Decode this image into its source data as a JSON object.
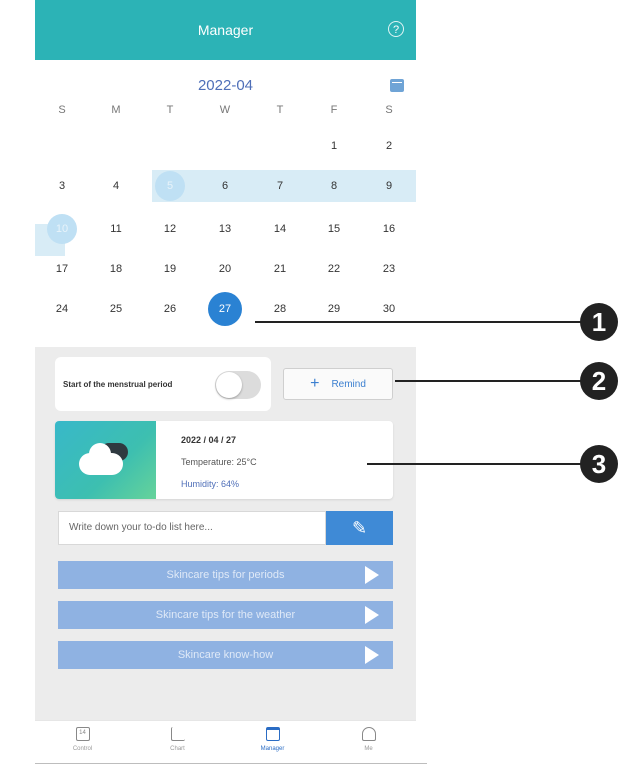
{
  "header": {
    "title": "Manager",
    "help_icon": "help-icon",
    "help_symbol": "?"
  },
  "calendar": {
    "month": "2022-04",
    "weekdays": [
      "S",
      "M",
      "T",
      "W",
      "T",
      "F",
      "S"
    ],
    "weeks": [
      [
        "",
        "",
        "",
        "",
        "",
        "1",
        "2"
      ],
      [
        "3",
        "4",
        "5",
        "6",
        "7",
        "8",
        "9"
      ],
      [
        "10",
        "11",
        "12",
        "13",
        "14",
        "15",
        "16"
      ],
      [
        "17",
        "18",
        "19",
        "20",
        "21",
        "22",
        "23"
      ],
      [
        "24",
        "25",
        "26",
        "27",
        "28",
        "29",
        "30"
      ]
    ],
    "selected_day": "27",
    "period_days": [
      "5",
      "6",
      "7",
      "8",
      "9",
      "10"
    ]
  },
  "period": {
    "label": "Start of the menstrual period",
    "toggle_on": false
  },
  "remind": {
    "label": "Remind",
    "icon": "plus-icon"
  },
  "weather": {
    "date": "2022 / 04 / 27",
    "temperature": "Temperature: 25°C",
    "humidity": "Humidity: 64%",
    "icon": "cloudy-night-icon"
  },
  "todo": {
    "placeholder": "Write down your to-do list here...",
    "icon": "pencil-icon"
  },
  "tips": [
    {
      "label": "Skincare tips for periods"
    },
    {
      "label": "Skincare tips for the weather"
    },
    {
      "label": "Skincare know-how"
    }
  ],
  "tabs": [
    {
      "label": "Control",
      "icon": "control-icon",
      "glyph": "14"
    },
    {
      "label": "Chart",
      "icon": "chart-icon",
      "glyph": "~"
    },
    {
      "label": "Manager",
      "icon": "calendar-icon",
      "glyph": ""
    },
    {
      "label": "Me",
      "icon": "person-icon",
      "glyph": ""
    }
  ],
  "active_tab": "Manager",
  "callouts": [
    "1",
    "2",
    "3"
  ],
  "colors": {
    "header": "#2cb3b6",
    "accent": "#2a82d3",
    "tip": "#8fb2e2"
  }
}
